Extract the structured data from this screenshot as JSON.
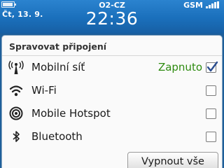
{
  "statusbar": {
    "date": "Čt, 13. 9.",
    "carrier": "O2-CZ",
    "time": "22:36",
    "network": "GSM",
    "battery_icon": "battery-icon",
    "signal_icon": "signal-strength-icon"
  },
  "dialog": {
    "title": "Spravovat připojení",
    "items": [
      {
        "label": "Mobilní síť",
        "status": "Zapnuto",
        "checked": true,
        "icon": "cellular-antenna-icon"
      },
      {
        "label": "Wi-Fi",
        "status": "",
        "checked": false,
        "icon": "wifi-icon"
      },
      {
        "label": "Mobile Hotspot",
        "status": "",
        "checked": false,
        "icon": "hotspot-icon"
      },
      {
        "label": "Bluetooth",
        "status": "",
        "checked": false,
        "icon": "bluetooth-icon"
      }
    ],
    "button_label": "Vypnout vše"
  },
  "colors": {
    "statusbar_blue": "#1a6fbb",
    "status_green": "#2e8b10"
  }
}
